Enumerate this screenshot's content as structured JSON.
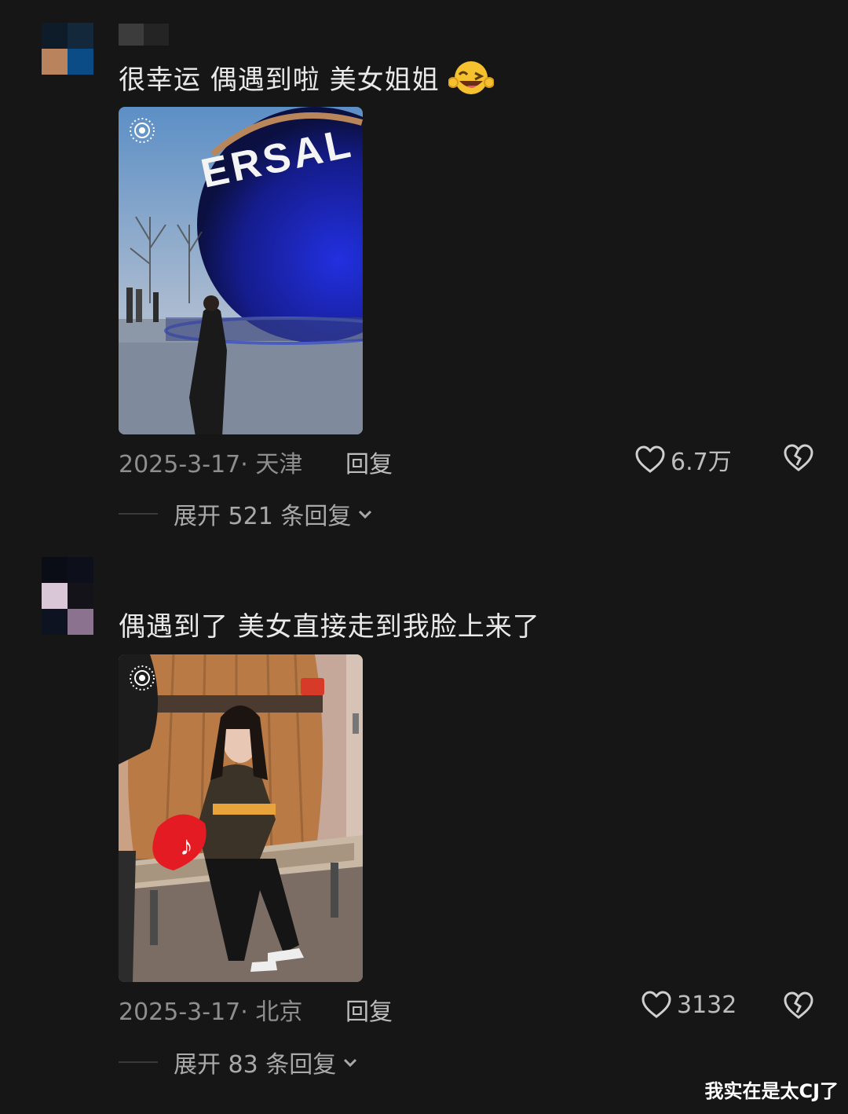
{
  "comments": [
    {
      "text": "很幸运 偶遇到啦 美女姐姐",
      "emoji": "laughing-winking-emoji",
      "image_sign_text": "ERSAL",
      "date_location": "2025-3-17· 天津",
      "reply_label": "回复",
      "likes": "6.7万",
      "expand_label": "展开 521 条回复"
    },
    {
      "text": "偶遇到了 美女直接走到我脸上来了",
      "date_location": "2025-3-17· 北京",
      "reply_label": "回复",
      "likes": "3132",
      "expand_label": "展开 83 条回复"
    }
  ],
  "watermark": "我实在是太CJ了",
  "colors": {
    "background": "#161616",
    "text": "#e9e9e9",
    "meta": "#8e8e8e"
  },
  "icons": [
    "heart-icon",
    "broken-heart-icon",
    "chevron-down-icon",
    "live-photo-icon"
  ]
}
